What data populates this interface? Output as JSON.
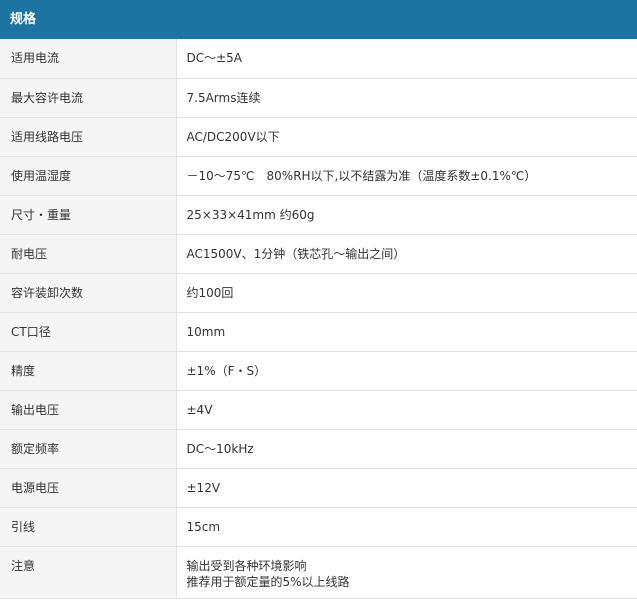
{
  "header": {
    "title": "规格"
  },
  "rows": [
    {
      "label": "适用电流",
      "value": "DC～±5A"
    },
    {
      "label": "最大容许电流",
      "value": "7.5Arms连续"
    },
    {
      "label": "适用线路电压",
      "value": "AC/DC200V以下"
    },
    {
      "label": "使用温湿度",
      "value": "－10～75℃　80%RH以下,以不结露为准（温度系数±0.1%℃）"
    },
    {
      "label": "尺寸・重量",
      "value": "25×33×41mm 约60g"
    },
    {
      "label": "耐电压",
      "value": "AC1500V、1分钟（铁芯孔～输出之间）"
    },
    {
      "label": "容许装卸次数",
      "value": "约100回"
    },
    {
      "label": "CT口径",
      "value": "10mm"
    },
    {
      "label": "精度",
      "value": "±1%（F・S）"
    },
    {
      "label": "输出电压",
      "value": "±4V"
    },
    {
      "label": "额定频率",
      "value": "DC～10kHz"
    },
    {
      "label": "电源电压",
      "value": "±12V"
    },
    {
      "label": "引线",
      "value": "15cm"
    }
  ],
  "note": {
    "label": "注意",
    "lines": [
      "输出受到各种环境影响",
      "推荐用于额定量的5%以上线路"
    ]
  }
}
